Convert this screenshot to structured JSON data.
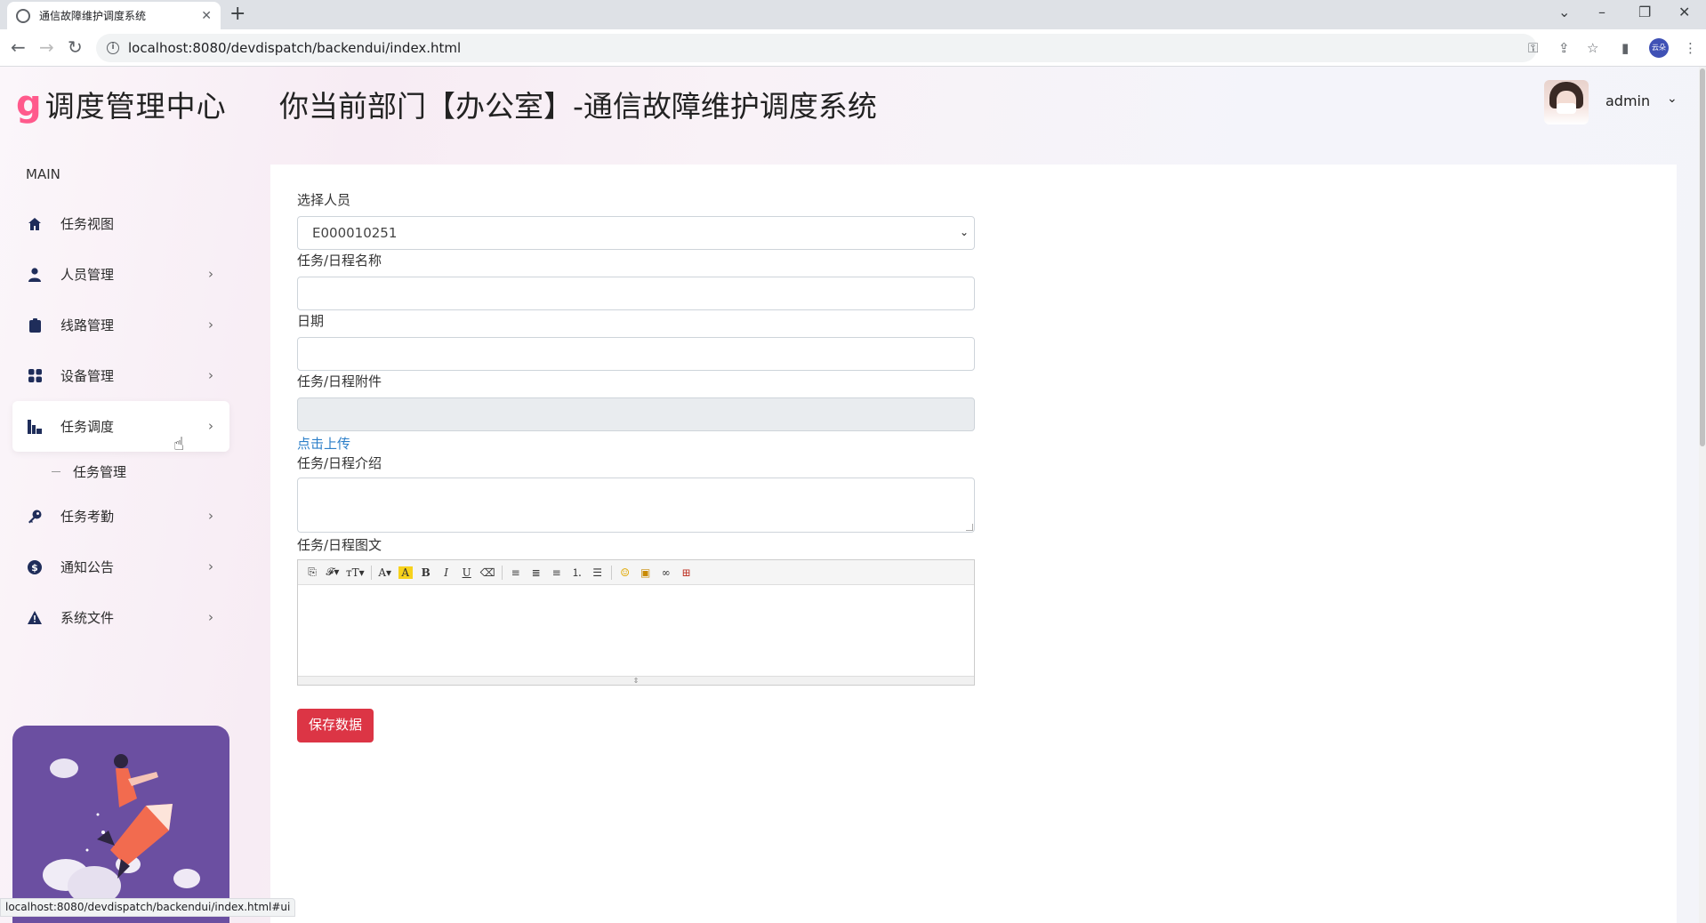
{
  "browser": {
    "tab_title": "通信故障维护调度系统",
    "new_tab": "+",
    "url": "localhost:8080/devdispatch/backendui/index.html",
    "status_url": "localhost:8080/devdispatch/backendui/index.html#ui",
    "profile_label": "云朵"
  },
  "brand": {
    "mark": "g",
    "name": "调度管理中心"
  },
  "header": {
    "title": "你当前部门【办公室】-通信故障维护调度系统",
    "user": "admin"
  },
  "sidebar": {
    "section": "MAIN",
    "items": [
      {
        "label": "任务视图",
        "icon": "home-icon",
        "chevron": false
      },
      {
        "label": "人员管理",
        "icon": "user-icon",
        "chevron": true
      },
      {
        "label": "线路管理",
        "icon": "clipboard-icon",
        "chevron": true
      },
      {
        "label": "设备管理",
        "icon": "grid-icon",
        "chevron": true
      },
      {
        "label": "任务调度",
        "icon": "chart-icon",
        "chevron": true,
        "active": true
      },
      {
        "label": "任务考勤",
        "icon": "key-icon",
        "chevron": true
      },
      {
        "label": "通知公告",
        "icon": "dollar-icon",
        "chevron": true
      },
      {
        "label": "系统文件",
        "icon": "warning-icon",
        "chevron": true
      }
    ],
    "submenu": {
      "label": "任务管理"
    }
  },
  "form": {
    "person_label": "选择人员",
    "person_value": "E000010251",
    "name_label": "任务/日程名称",
    "name_value": "",
    "date_label": "日期",
    "date_value": "",
    "attach_label": "任务/日程附件",
    "attach_value": "",
    "upload_link": "点击上传",
    "intro_label": "任务/日程介绍",
    "richtext_label": "任务/日程图文",
    "save_button": "保存数据"
  },
  "colors": {
    "accent": "#dc3545",
    "link": "#2c7fc9",
    "brand_mark": "#ff5a8c",
    "promo_bg": "#6b4fa1"
  }
}
